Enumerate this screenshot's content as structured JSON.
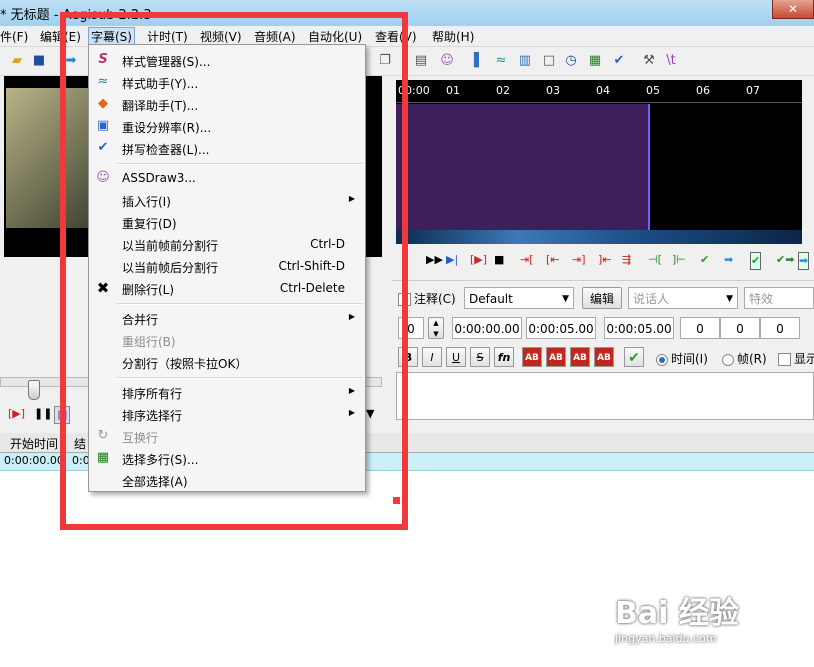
{
  "window": {
    "title": "* 无标题 - Aegisub 2.2.3",
    "close": "✕"
  },
  "menubar": {
    "items": [
      "件(F)",
      "编辑(E)",
      "字幕(S)",
      "计时(T)",
      "视频(V)",
      "音频(A)",
      "自动化(U)",
      "查看(V)",
      "帮助(H)"
    ]
  },
  "subtitle_menu": {
    "items": [
      {
        "label": "样式管理器(S)...",
        "icon": "style-manager-icon"
      },
      {
        "label": "样式助手(Y)...",
        "icon": "styling-assistant-icon"
      },
      {
        "label": "翻译助手(T)...",
        "icon": "translation-assistant-icon"
      },
      {
        "label": "重设分辨率(R)...",
        "icon": "resample-resolution-icon"
      },
      {
        "label": "拼写检查器(L)...",
        "icon": "spellchecker-icon"
      },
      {
        "label": "ASSDraw3...",
        "icon": "assdraw-icon"
      },
      {
        "label": "插入行(I)",
        "submenu": true
      },
      {
        "label": "重复行(D)"
      },
      {
        "label": "以当前帧前分割行",
        "shortcut": "Ctrl-D"
      },
      {
        "label": "以当前帧后分割行",
        "shortcut": "Ctrl-Shift-D"
      },
      {
        "label": "删除行(L)",
        "shortcut": "Ctrl-Delete",
        "icon": "delete-x-icon"
      },
      {
        "label": "合并行",
        "submenu": true
      },
      {
        "label": "重组行(B)",
        "disabled": true
      },
      {
        "label": "分割行（按照卡拉OK）"
      },
      {
        "label": "排序所有行",
        "submenu": true
      },
      {
        "label": "排序选择行",
        "submenu": true
      },
      {
        "label": "互换行",
        "disabled": true,
        "icon": "swap-icon"
      },
      {
        "label": "选择多行(S)...",
        "icon": "select-lines-icon"
      },
      {
        "label": "全部选择(A)"
      }
    ]
  },
  "audio": {
    "timeline": [
      "00:00",
      "01",
      "02",
      "03",
      "04",
      "05",
      "06",
      "07"
    ]
  },
  "edit_box": {
    "comment_label": "注释(C)",
    "style": "Default",
    "edit_button": "编辑",
    "actor_placeholder": "说话人",
    "effect_placeholder": "特效",
    "layer": "0",
    "start_time": "0:00:00.00",
    "end_time": "0:00:05.00",
    "duration": "0:00:05.00",
    "margin_l": "0",
    "margin_r": "0",
    "margin_v": "0",
    "format_buttons": [
      "B",
      "I",
      "U",
      "S",
      "fn",
      "AB",
      "AB",
      "AB",
      "AB"
    ],
    "time_label": "时间(I)",
    "frame_label": "帧(R)",
    "show_original_label": "显示"
  },
  "grid": {
    "headers": [
      "开始时间",
      "结"
    ],
    "rows": [
      {
        "start": "0:00:00.00",
        "end": "0:0"
      }
    ]
  },
  "watermark": {
    "text": "Bai  经验",
    "url": "jingyan.baidu.com"
  },
  "colors": {
    "annotation": "#f0393c",
    "grid_row": "#c9f0f6",
    "audio_selection": "#3e1f5c"
  }
}
